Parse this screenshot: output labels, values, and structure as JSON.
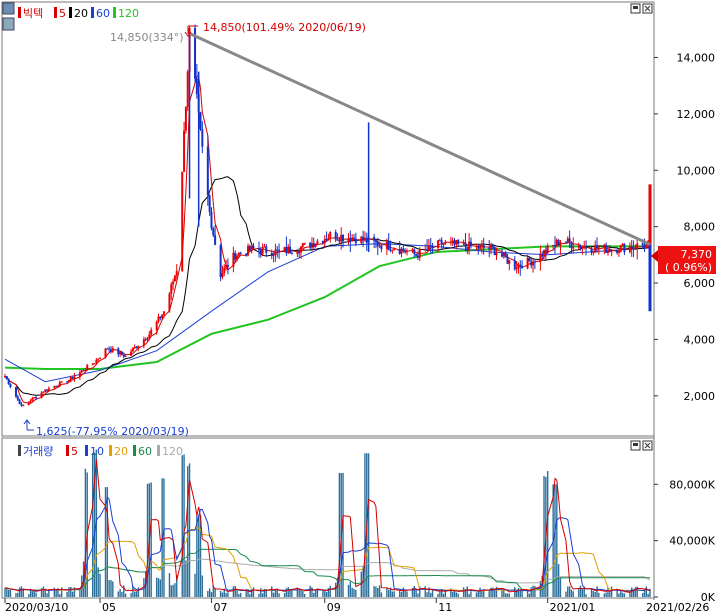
{
  "price_panel": {
    "title": "빅텍",
    "legend": [
      {
        "label": "5",
        "color": "#d40000"
      },
      {
        "label": "20",
        "color": "#000000"
      },
      {
        "label": "60",
        "color": "#1a3fd6"
      },
      {
        "label": "120",
        "color": "#22c422"
      }
    ],
    "high_annotation": "14,850(101.49% 2020/06/19)",
    "high_angle_annotation": "14,850(334°)",
    "low_annotation": "1,625(-77.95% 2020/03/19)",
    "current_price": "7,370",
    "current_change": "( 0.96%)",
    "yticks": [
      "14,000",
      "12,000",
      "10,000",
      "8,000",
      "6,000",
      "4,000",
      "2,000"
    ]
  },
  "volume_panel": {
    "title": "거래량",
    "legend": [
      {
        "label": "5",
        "color": "#d40000"
      },
      {
        "label": "10",
        "color": "#1a3fd6"
      },
      {
        "label": "20",
        "color": "#e0a000"
      },
      {
        "label": "60",
        "color": "#1a8c4a"
      },
      {
        "label": "120",
        "color": "#aaaaaa"
      }
    ],
    "yticks": [
      "80,000K",
      "40,000K",
      "0K"
    ]
  },
  "x_axis": {
    "ticks": [
      "2020/03/10",
      "05",
      "07",
      "09",
      "11",
      "2021/01"
    ],
    "end_label": "2021/02/26"
  },
  "chart_data": {
    "type": "candlestick",
    "price_ylim": [
      1000,
      15400
    ],
    "volume_ylim": [
      0,
      110000
    ],
    "volume_unit": "K",
    "price_points": [
      [
        "2020-03-10",
        2700
      ],
      [
        "2020-03-19",
        1625
      ],
      [
        "2020-04-01",
        2200
      ],
      [
        "2020-04-15",
        2600
      ],
      [
        "2020-04-28",
        3200
      ],
      [
        "2020-05-05",
        3700
      ],
      [
        "2020-05-15",
        3400
      ],
      [
        "2020-05-28",
        4200
      ],
      [
        "2020-06-05",
        5000
      ],
      [
        "2020-06-12",
        6500
      ],
      [
        "2020-06-19",
        14850
      ],
      [
        "2020-06-24",
        11800
      ],
      [
        "2020-06-30",
        8500
      ],
      [
        "2020-07-06",
        6300
      ],
      [
        "2020-07-14",
        7000
      ],
      [
        "2020-07-24",
        7200
      ],
      [
        "2020-08-07",
        7100
      ],
      [
        "2020-08-21",
        7300
      ],
      [
        "2020-09-04",
        7700
      ],
      [
        "2020-09-18",
        7600
      ],
      [
        "2020-09-29",
        7400
      ],
      [
        "2020-10-08",
        7300
      ],
      [
        "2020-10-21",
        7000
      ],
      [
        "2020-11-04",
        7400
      ],
      [
        "2020-11-18",
        7300
      ],
      [
        "2020-12-02",
        7200
      ],
      [
        "2020-12-14",
        6600
      ],
      [
        "2020-12-24",
        6800
      ],
      [
        "2021-01-08",
        7500
      ],
      [
        "2021-01-20",
        7300
      ],
      [
        "2021-02-03",
        7200
      ],
      [
        "2021-02-16",
        7300
      ],
      [
        "2021-02-26",
        7370
      ]
    ],
    "ma120_points": [
      [
        "2020-03-10",
        3000
      ],
      [
        "2020-04-01",
        2950
      ],
      [
        "2020-05-01",
        2950
      ],
      [
        "2020-06-01",
        3200
      ],
      [
        "2020-07-01",
        4200
      ],
      [
        "2020-08-01",
        4700
      ],
      [
        "2020-09-01",
        5500
      ],
      [
        "2020-10-01",
        6600
      ],
      [
        "2020-11-01",
        7100
      ],
      [
        "2020-12-01",
        7200
      ],
      [
        "2021-01-01",
        7300
      ],
      [
        "2021-02-26",
        7300
      ]
    ],
    "ma60_points": [
      [
        "2020-03-10",
        3300
      ],
      [
        "2020-04-01",
        2500
      ],
      [
        "2020-05-01",
        2900
      ],
      [
        "2020-06-01",
        3600
      ],
      [
        "2020-07-01",
        5000
      ],
      [
        "2020-08-01",
        6400
      ],
      [
        "2020-09-01",
        7300
      ],
      [
        "2020-10-01",
        7400
      ],
      [
        "2020-11-01",
        7300
      ],
      [
        "2020-12-01",
        7100
      ],
      [
        "2021-01-01",
        7000
      ],
      [
        "2021-02-26",
        7250
      ]
    ],
    "trendline": [
      [
        "2020-06-19",
        14850
      ],
      [
        "2021-02-26",
        7370
      ]
    ],
    "last_bar": {
      "date": "2021-02-26",
      "high": 9500,
      "low": 5000
    },
    "volume_peaks": [
      [
        "2020-04-24",
        86000
      ],
      [
        "2020-04-28",
        102000
      ],
      [
        "2020-05-04",
        78000
      ],
      [
        "2020-05-28",
        80000
      ],
      [
        "2020-06-05",
        84000
      ],
      [
        "2020-06-15",
        98000
      ],
      [
        "2020-06-19",
        92000
      ],
      [
        "2020-06-24",
        58000
      ],
      [
        "2020-09-10",
        88000
      ],
      [
        "2020-09-24",
        102000
      ],
      [
        "2020-12-31",
        84000
      ],
      [
        "2021-01-05",
        80000
      ]
    ]
  }
}
